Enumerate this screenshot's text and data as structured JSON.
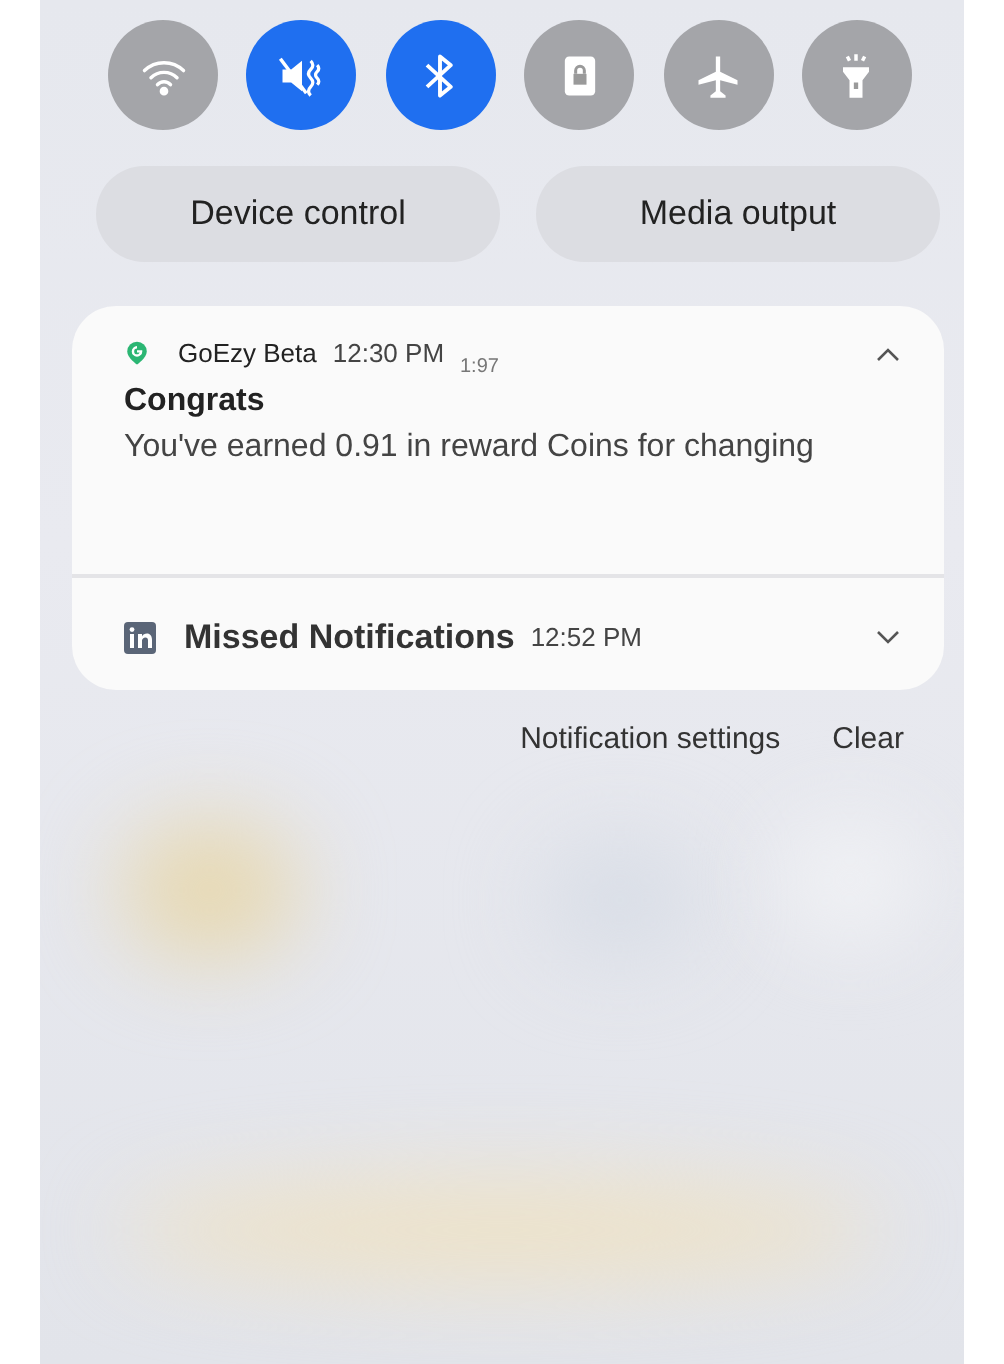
{
  "quick_toggles": [
    {
      "kind": "wifi",
      "on": false
    },
    {
      "kind": "mute",
      "on": true
    },
    {
      "kind": "bluetooth",
      "on": true
    },
    {
      "kind": "lock",
      "on": false
    },
    {
      "kind": "airplane",
      "on": false
    },
    {
      "kind": "flashlight",
      "on": false
    }
  ],
  "shortcuts": [
    "Device control",
    "Media output"
  ],
  "notifications": [
    {
      "kind": "app",
      "app": "GoEzy Beta",
      "time": "12:30 PM",
      "overlay_text": "1:97",
      "title": "Congrats",
      "body": "You've earned 0.91 in reward Coins for changing",
      "expanded": true
    },
    {
      "kind": "linkedin",
      "app": "Missed Notifications",
      "time": "12:52 PM",
      "expanded": false
    }
  ],
  "actions": [
    "Notification settings",
    "Clear"
  ]
}
